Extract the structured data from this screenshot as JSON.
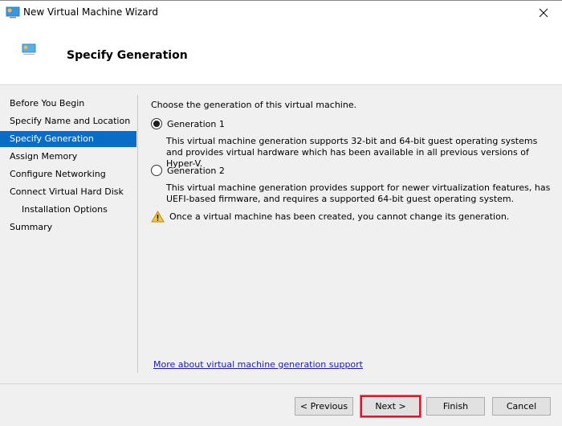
{
  "window": {
    "title": "New Virtual Machine Wizard",
    "icon": "virtual-machine-icon",
    "close_icon": "close-icon"
  },
  "header": {
    "title": "Specify Generation",
    "icon": "virtual-machine-icon"
  },
  "sidebar": {
    "items": [
      {
        "label": "Before You Begin",
        "active": false,
        "indent": false
      },
      {
        "label": "Specify Name and Location",
        "active": false,
        "indent": false
      },
      {
        "label": "Specify Generation",
        "active": true,
        "indent": false
      },
      {
        "label": "Assign Memory",
        "active": false,
        "indent": false
      },
      {
        "label": "Configure Networking",
        "active": false,
        "indent": false
      },
      {
        "label": "Connect Virtual Hard Disk",
        "active": false,
        "indent": false
      },
      {
        "label": "Installation Options",
        "active": false,
        "indent": true
      },
      {
        "label": "Summary",
        "active": false,
        "indent": false
      }
    ],
    "active_color": "#0a6cc4"
  },
  "content": {
    "prompt": "Choose the generation of this virtual machine.",
    "options": [
      {
        "label": "Generation 1",
        "selected": true,
        "description": "This virtual machine generation supports 32-bit and 64-bit guest operating systems and provides virtual hardware which has been available in all previous versions of Hyper-V."
      },
      {
        "label": "Generation 2",
        "selected": false,
        "description": "This virtual machine generation provides support for newer virtualization features, has UEFI-based firmware, and requires a supported 64-bit guest operating system."
      }
    ],
    "warning": {
      "icon": "warning-icon",
      "text": "Once a virtual machine has been created, you cannot change its generation."
    },
    "more_link": "More about virtual machine generation support"
  },
  "footer": {
    "previous_label": "< Previous",
    "next_label": "Next >",
    "finish_label": "Finish",
    "cancel_label": "Cancel",
    "highlight_color": "#c8202e"
  }
}
